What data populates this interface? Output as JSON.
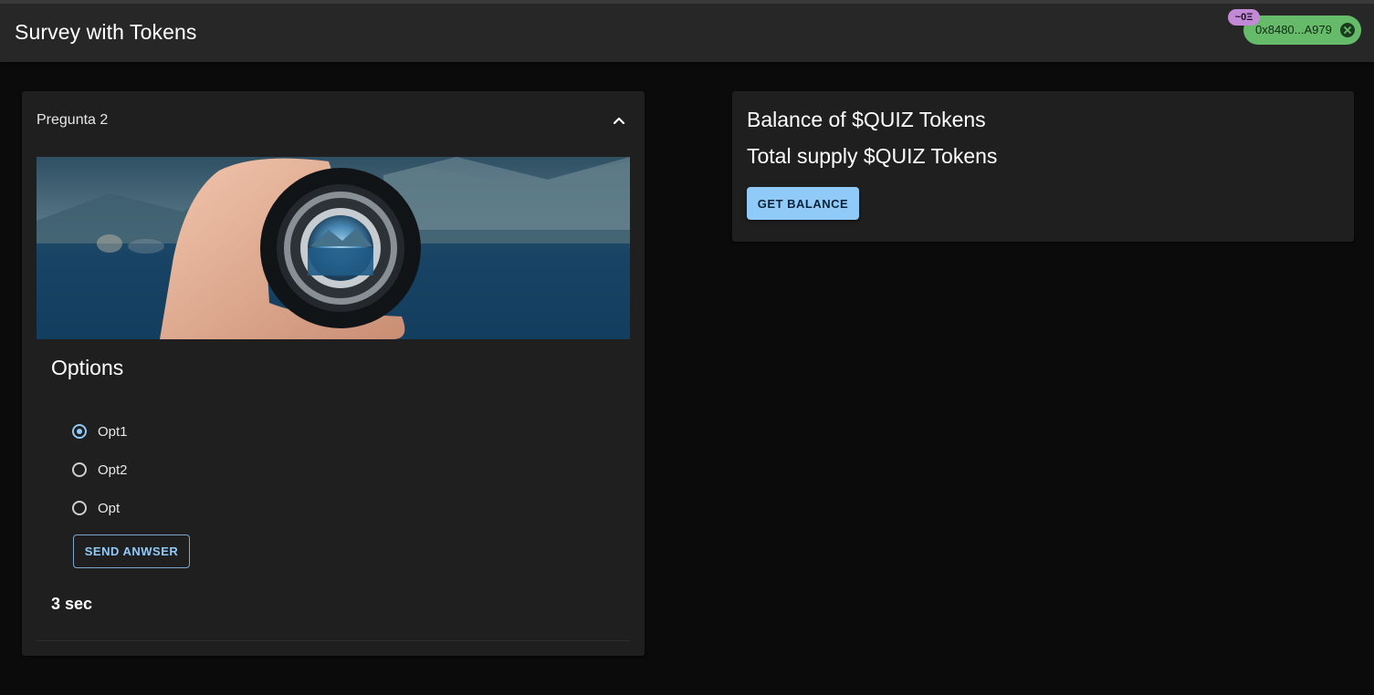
{
  "appbar": {
    "title": "Survey with Tokens",
    "wallet_address": "0x8480...A979",
    "wallet_balance_badge": "~0Ξ",
    "wallet_color": "#66bb6a",
    "badge_color": "#c28ad6"
  },
  "question": {
    "title": "Pregunta 2",
    "expand_icon": "chevron-up-icon",
    "image_description_icon": "camera-lens-photo",
    "options_heading": "Options",
    "options": [
      {
        "label": "Opt1",
        "checked": true
      },
      {
        "label": "Opt2",
        "checked": false
      },
      {
        "label": "Opt",
        "checked": false
      }
    ],
    "send_button": "SEND ANWSER",
    "timer": "3 sec"
  },
  "tokens": {
    "balance_label": "Balance of $QUIZ Tokens",
    "supply_label": "Total supply $QUIZ Tokens",
    "get_balance_button": "GET BALANCE",
    "accent_color": "#90caf9"
  }
}
